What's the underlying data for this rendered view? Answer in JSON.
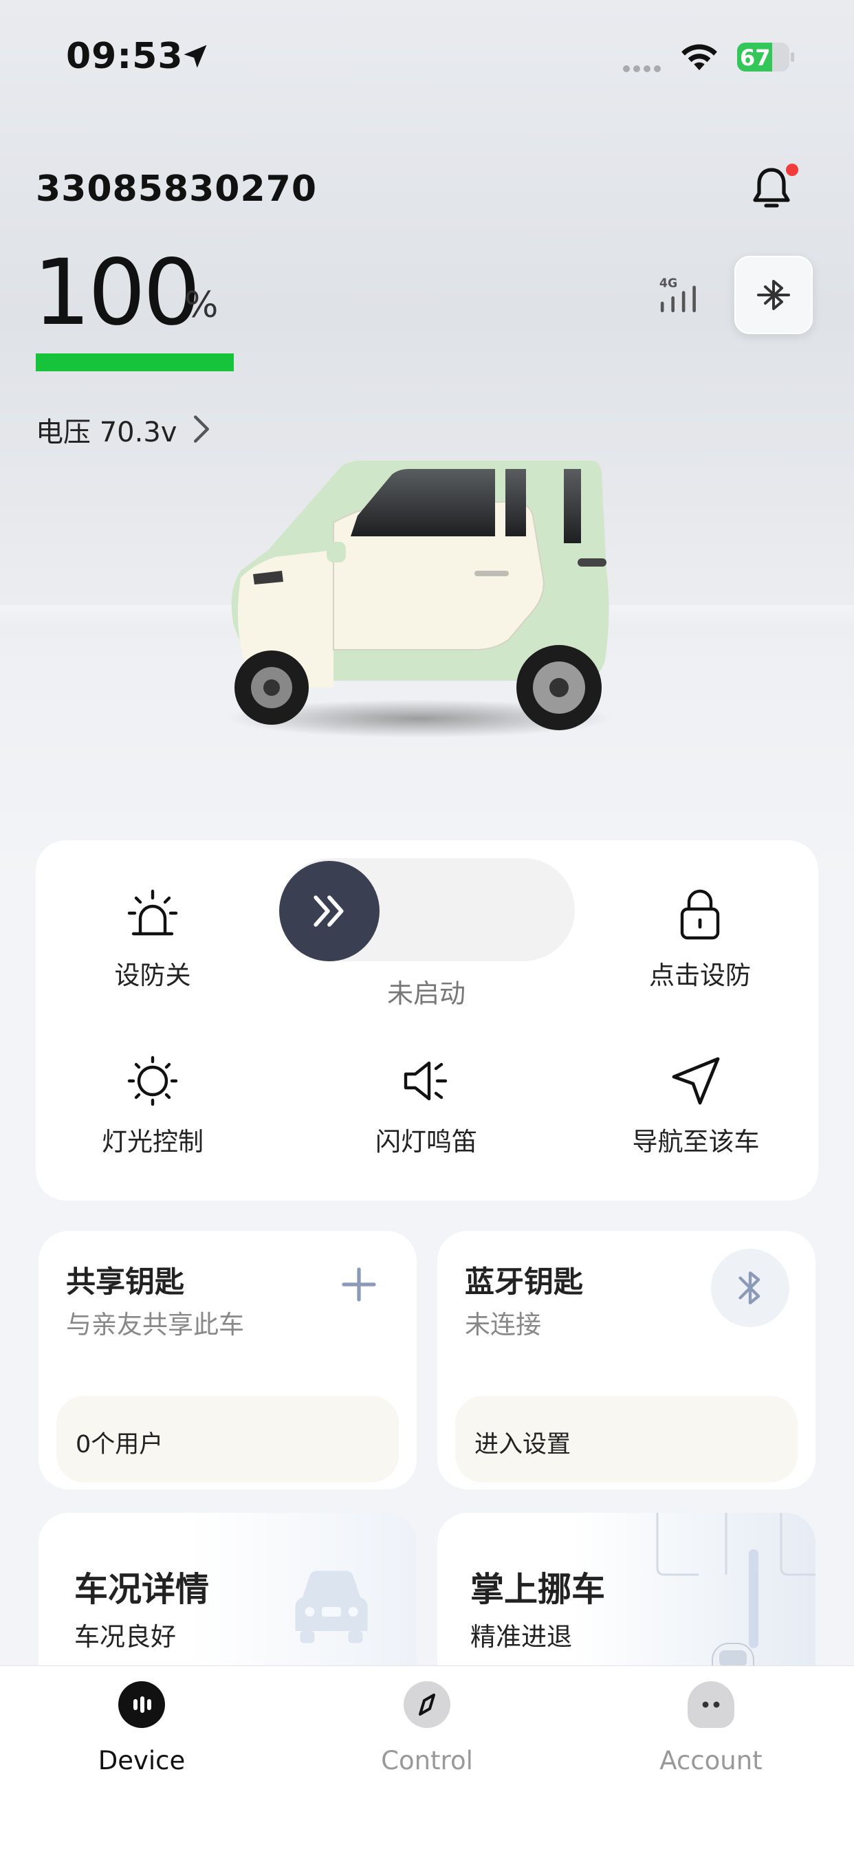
{
  "status_bar": {
    "time": "09:53",
    "battery_level": "67"
  },
  "header": {
    "vehicle_id": "33085830270"
  },
  "charge": {
    "value": "100",
    "unit": "%",
    "fraction": 1.0,
    "bar_color": "#17c33b"
  },
  "voltage": {
    "label": "电压 70.3v"
  },
  "network": {
    "label": "4G"
  },
  "controls": {
    "alarm": "设防关",
    "start_status": "未启动",
    "arm": "点击设防",
    "lights": "灯光控制",
    "flash_horn": "闪灯鸣笛",
    "navigate": "导航至该车"
  },
  "shared_key": {
    "title": "共享钥匙",
    "subtitle": "与亲友共享此车",
    "users": "0个用户"
  },
  "bluetooth_key": {
    "title": "蓝牙钥匙",
    "subtitle": "未连接",
    "action": "进入设置"
  },
  "vehicle_condition": {
    "title": "车况详情",
    "subtitle": "车况良好"
  },
  "remote_move": {
    "title": "掌上挪车",
    "subtitle": "精准进退"
  },
  "tabs": [
    {
      "label": "Device",
      "icon": "device-icon",
      "active": true
    },
    {
      "label": "Control",
      "icon": "compass-icon",
      "active": false
    },
    {
      "label": "Account",
      "icon": "account-icon",
      "active": false
    }
  ],
  "colors": {
    "accent_green": "#17c33b",
    "knob_dark": "#3a3f52",
    "notification_dot": "#f23b3b"
  }
}
